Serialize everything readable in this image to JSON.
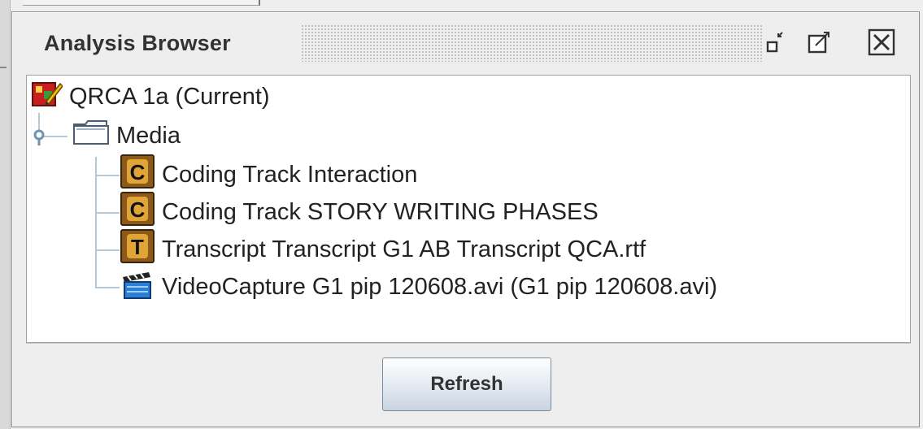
{
  "window": {
    "title": "Analysis Browser",
    "controls": [
      "minimize-icon",
      "maximize-icon",
      "close-icon"
    ]
  },
  "tree": {
    "root": {
      "label": "QRCA 1a (Current)",
      "icon": "project-icon"
    },
    "folder": {
      "label": "Media",
      "icon": "folder-icon",
      "expanded": true
    },
    "items": [
      {
        "label": "Coding Track Interaction",
        "icon": "coding-track-icon",
        "glyph": "C"
      },
      {
        "label": "Coding Track STORY WRITING PHASES",
        "icon": "coding-track-icon",
        "glyph": "C"
      },
      {
        "label": "Transcript Transcript G1 AB Transcript QCA.rtf",
        "icon": "transcript-icon",
        "glyph": "T"
      },
      {
        "label": "VideoCapture G1 pip 120608.avi (G1 pip 120608.avi)",
        "icon": "video-icon"
      }
    ]
  },
  "footer": {
    "refresh_label": "Refresh"
  },
  "colors": {
    "frame_bg": "#eeeeee",
    "tree_bg": "#ffffff",
    "button_border": "#7a8a99",
    "connector": "#b5c8d6"
  }
}
